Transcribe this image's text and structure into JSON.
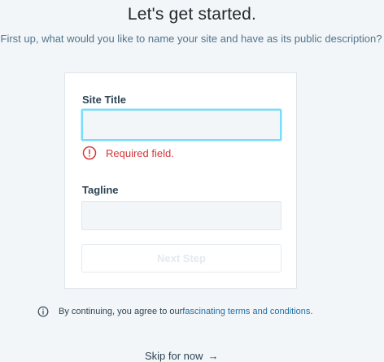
{
  "header": {
    "title": "Let's get started.",
    "subtitle": "First up, what would you like to name your site and have as its public description?"
  },
  "form": {
    "site_title_label": "Site Title",
    "site_title_value": "",
    "error_message": "Required field.",
    "tagline_label": "Tagline",
    "tagline_value": "",
    "next_button_label": "Next Step"
  },
  "footer": {
    "terms_prefix": "By continuing, you agree to our ",
    "terms_link": "fascinating terms and conditions",
    "terms_suffix": ".",
    "skip_label": "Skip for now",
    "skip_arrow": "→"
  },
  "colors": {
    "error": "#d63638",
    "link": "#1e6ea8",
    "focus_border": "#78dcfa",
    "background": "#f3f6f8"
  },
  "icons": {
    "error": "alert-circle-icon",
    "info": "info-icon"
  }
}
